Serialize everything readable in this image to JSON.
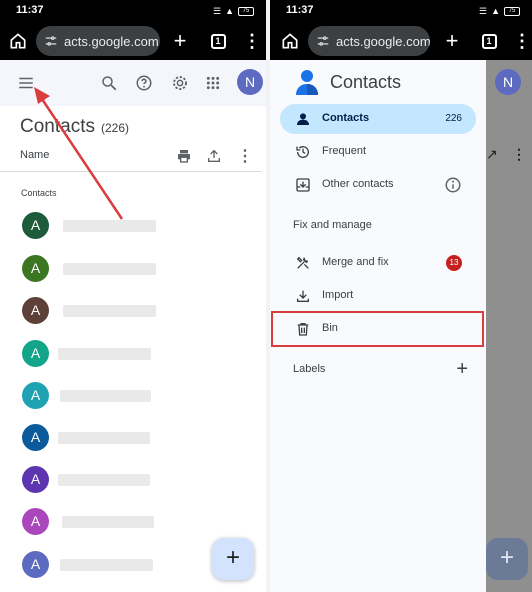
{
  "status_bar": {
    "time": "11:37",
    "battery": "75"
  },
  "browser": {
    "url": "acts.google.com",
    "tab_count": "1"
  },
  "left_screen": {
    "page_title": "Contacts",
    "contact_count": "(226)",
    "column_header": "Name",
    "section_label": "Contacts",
    "profile_initial": "N",
    "contacts": [
      {
        "initial": "A",
        "color": "#1e5b3b"
      },
      {
        "initial": "A",
        "color": "#3b7722"
      },
      {
        "initial": "A",
        "color": "#5d4037"
      },
      {
        "initial": "A",
        "color": "#12a58a"
      },
      {
        "initial": "A",
        "color": "#1fa3b3"
      },
      {
        "initial": "A",
        "color": "#0a5a9c"
      },
      {
        "initial": "A",
        "color": "#5e35b1"
      },
      {
        "initial": "A",
        "color": "#ab47bc"
      },
      {
        "initial": "A",
        "color": "#5c6bc0"
      }
    ],
    "fab_icon": "+"
  },
  "right_screen": {
    "drawer_title": "Contacts",
    "profile_initial": "N",
    "nav": {
      "contacts_label": "Contacts",
      "contacts_count": "226",
      "frequent_label": "Frequent",
      "other_contacts_label": "Other contacts",
      "fix_manage_heading": "Fix and manage",
      "merge_label": "Merge and fix",
      "merge_badge": "13",
      "import_label": "Import",
      "bin_label": "Bin",
      "labels_heading": "Labels",
      "labels_add": "+"
    },
    "fab_icon": "+"
  },
  "colors": {
    "accent_blue": "#c2e7ff",
    "badge_red": "#c5221f",
    "annotation_red": "#d93d3d"
  }
}
